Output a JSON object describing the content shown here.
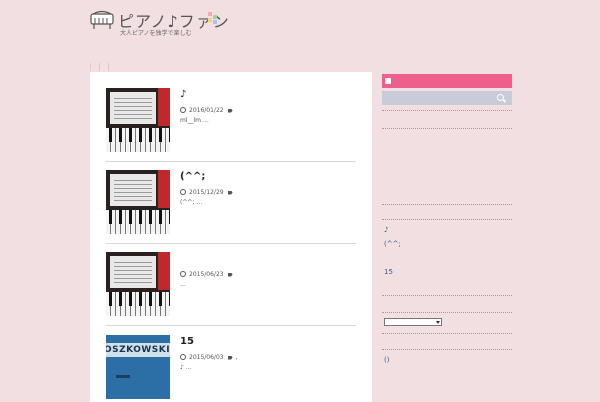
{
  "header": {
    "site_title": "ピアノ♪ファン",
    "tagline": "大人ピアノを独学で楽しむ",
    "brand_colors": [
      "#f3a8b8",
      "#9fd6a0",
      "#f4d27a",
      "#9ec8ef"
    ]
  },
  "posts": [
    {
      "title": "♪",
      "date": "2016/01/22",
      "extra": "",
      "excerpt": "ml__lm …",
      "thumb": "piano-keys"
    },
    {
      "title": "(^^;",
      "date": "2015/12/29",
      "extra": "",
      "excerpt": "(^^; …",
      "thumb": "piano-keys"
    },
    {
      "title": "",
      "date": "2015/06/23",
      "extra": "",
      "excerpt": "…",
      "thumb": "piano-keys"
    },
    {
      "title": "15",
      "date": "2015/06/03",
      "extra": ",",
      "excerpt": "♪ …",
      "thumb": "book-cover",
      "thumb_text": "OSZKOWSKI"
    }
  ],
  "sidebar": {
    "recent_links": [
      "♪",
      "(^^;",
      "15"
    ],
    "archive_select": "",
    "footer_link": "()"
  },
  "colors": {
    "page_bg": "#f2dfe2",
    "accent": "#ee5f8e",
    "search_bg": "#c9ccd8",
    "link": "#3a5f8a"
  }
}
